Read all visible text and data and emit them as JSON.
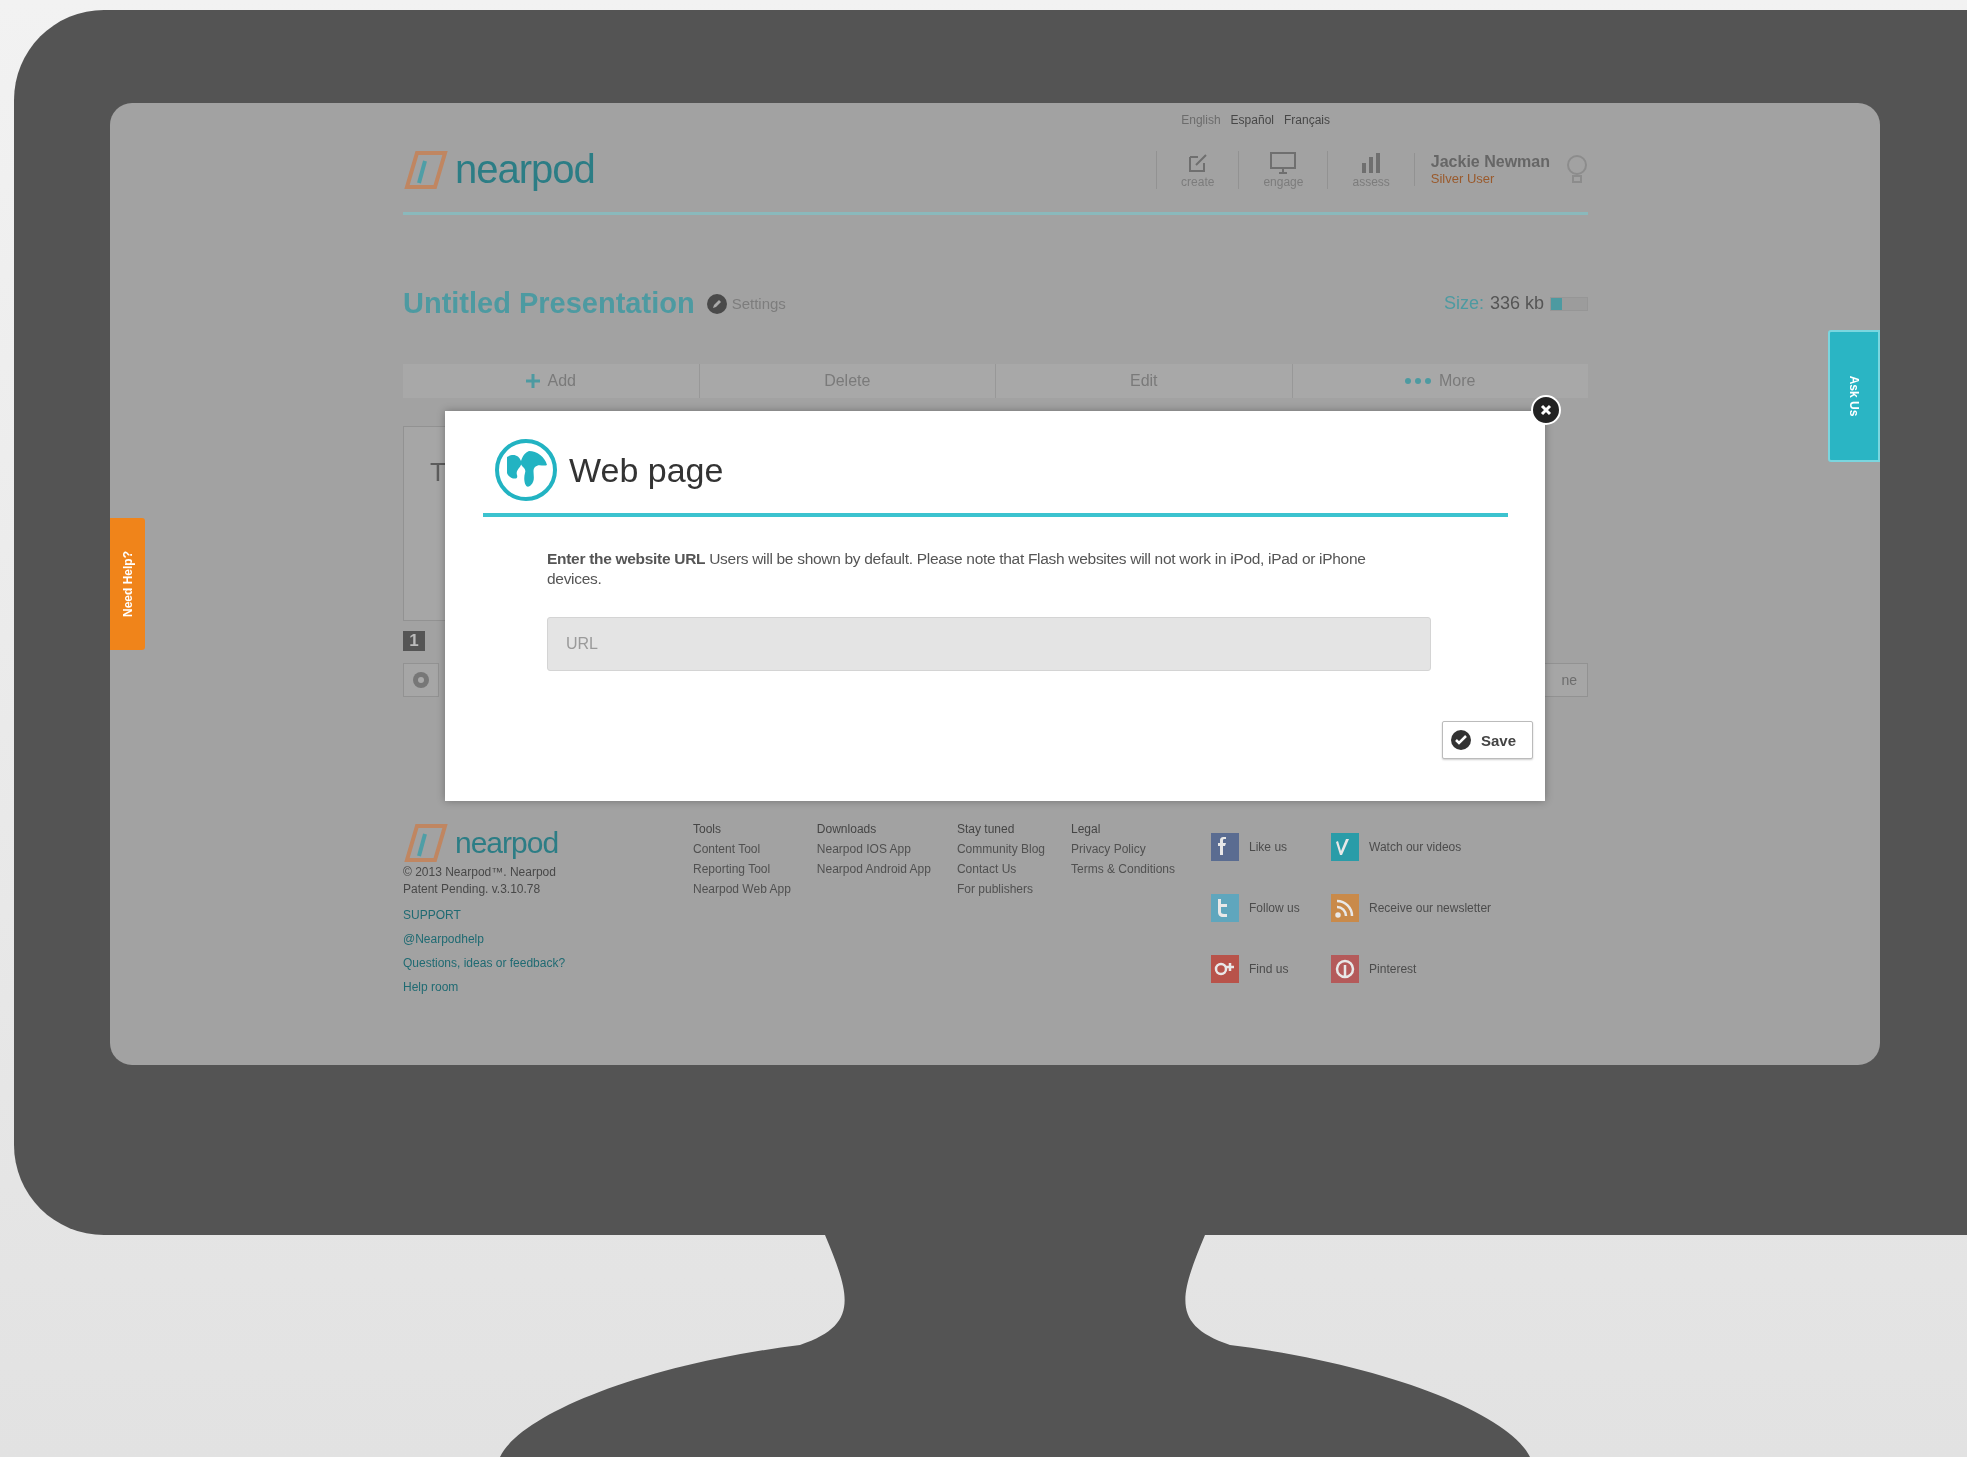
{
  "logo": "nearpod",
  "languages": [
    {
      "label": "English",
      "selected": true
    },
    {
      "label": "Español",
      "selected": false
    },
    {
      "label": "Français",
      "selected": false
    }
  ],
  "nav": [
    {
      "kind": "create",
      "label": "create"
    },
    {
      "kind": "engage",
      "label": "engage"
    },
    {
      "kind": "assess",
      "label": "assess"
    }
  ],
  "user": {
    "name": "Jackie Newman",
    "role": "Silver User"
  },
  "presentation": {
    "title": "Untitled Presentation",
    "settings": "Settings",
    "size_label": "Size:",
    "size_value": "336 kb",
    "level": 0.3
  },
  "toolbar": [
    {
      "kind": "add",
      "label": "Add"
    },
    {
      "kind": "delete",
      "label": "Delete"
    },
    {
      "kind": "edit",
      "label": "Edit"
    },
    {
      "kind": "more",
      "label": "More"
    }
  ],
  "slide": {
    "text": "T",
    "number": "1",
    "button_text": "ne"
  },
  "side_tabs": {
    "left": "Need Help?",
    "right": "Ask Us"
  },
  "dialog": {
    "title": "Web page",
    "bold_lead": "Enter the website URL",
    "description": "Users will be shown by default. Please note that Flash websites will not work in iPod, iPad or iPhone devices.",
    "placeholder": "URL",
    "save": "Save"
  },
  "footer": {
    "logo": "nearpod",
    "copyright": [
      "© 2013 Nearpod™. Nearpod",
      "Patent Pending. v.3.10.78"
    ],
    "links": [
      "SUPPORT",
      "@Nearpodhelp",
      "Questions, ideas or feedback?",
      "Help room"
    ],
    "columns": [
      {
        "heading": "Tools",
        "items": [
          "Content Tool",
          "Reporting Tool",
          "Nearpod Web App"
        ]
      },
      {
        "heading": "Downloads",
        "items": [
          "Nearpod IOS App",
          "Nearpod Android App"
        ]
      },
      {
        "heading": "Stay tuned",
        "items": [
          "Community Blog",
          "Contact Us",
          "For publishers"
        ]
      },
      {
        "heading": "Legal",
        "items": [
          "Privacy Policy",
          "Terms & Conditions"
        ]
      }
    ],
    "social": [
      {
        "kind": "facebook",
        "label": "Like us",
        "color": "#5a6c91"
      },
      {
        "kind": "vimeo",
        "label": "Watch our videos",
        "color": "#2a9ca8"
      },
      {
        "kind": "twitter",
        "label": "Follow us",
        "color": "#5fa6bd"
      },
      {
        "kind": "rss",
        "label": "Receive our newsletter",
        "color": "#c98a4a"
      },
      {
        "kind": "google",
        "label": "Find us",
        "color": "#b8534a"
      },
      {
        "kind": "pinterest",
        "label": "Pinterest",
        "color": "#b45a5a"
      }
    ]
  }
}
